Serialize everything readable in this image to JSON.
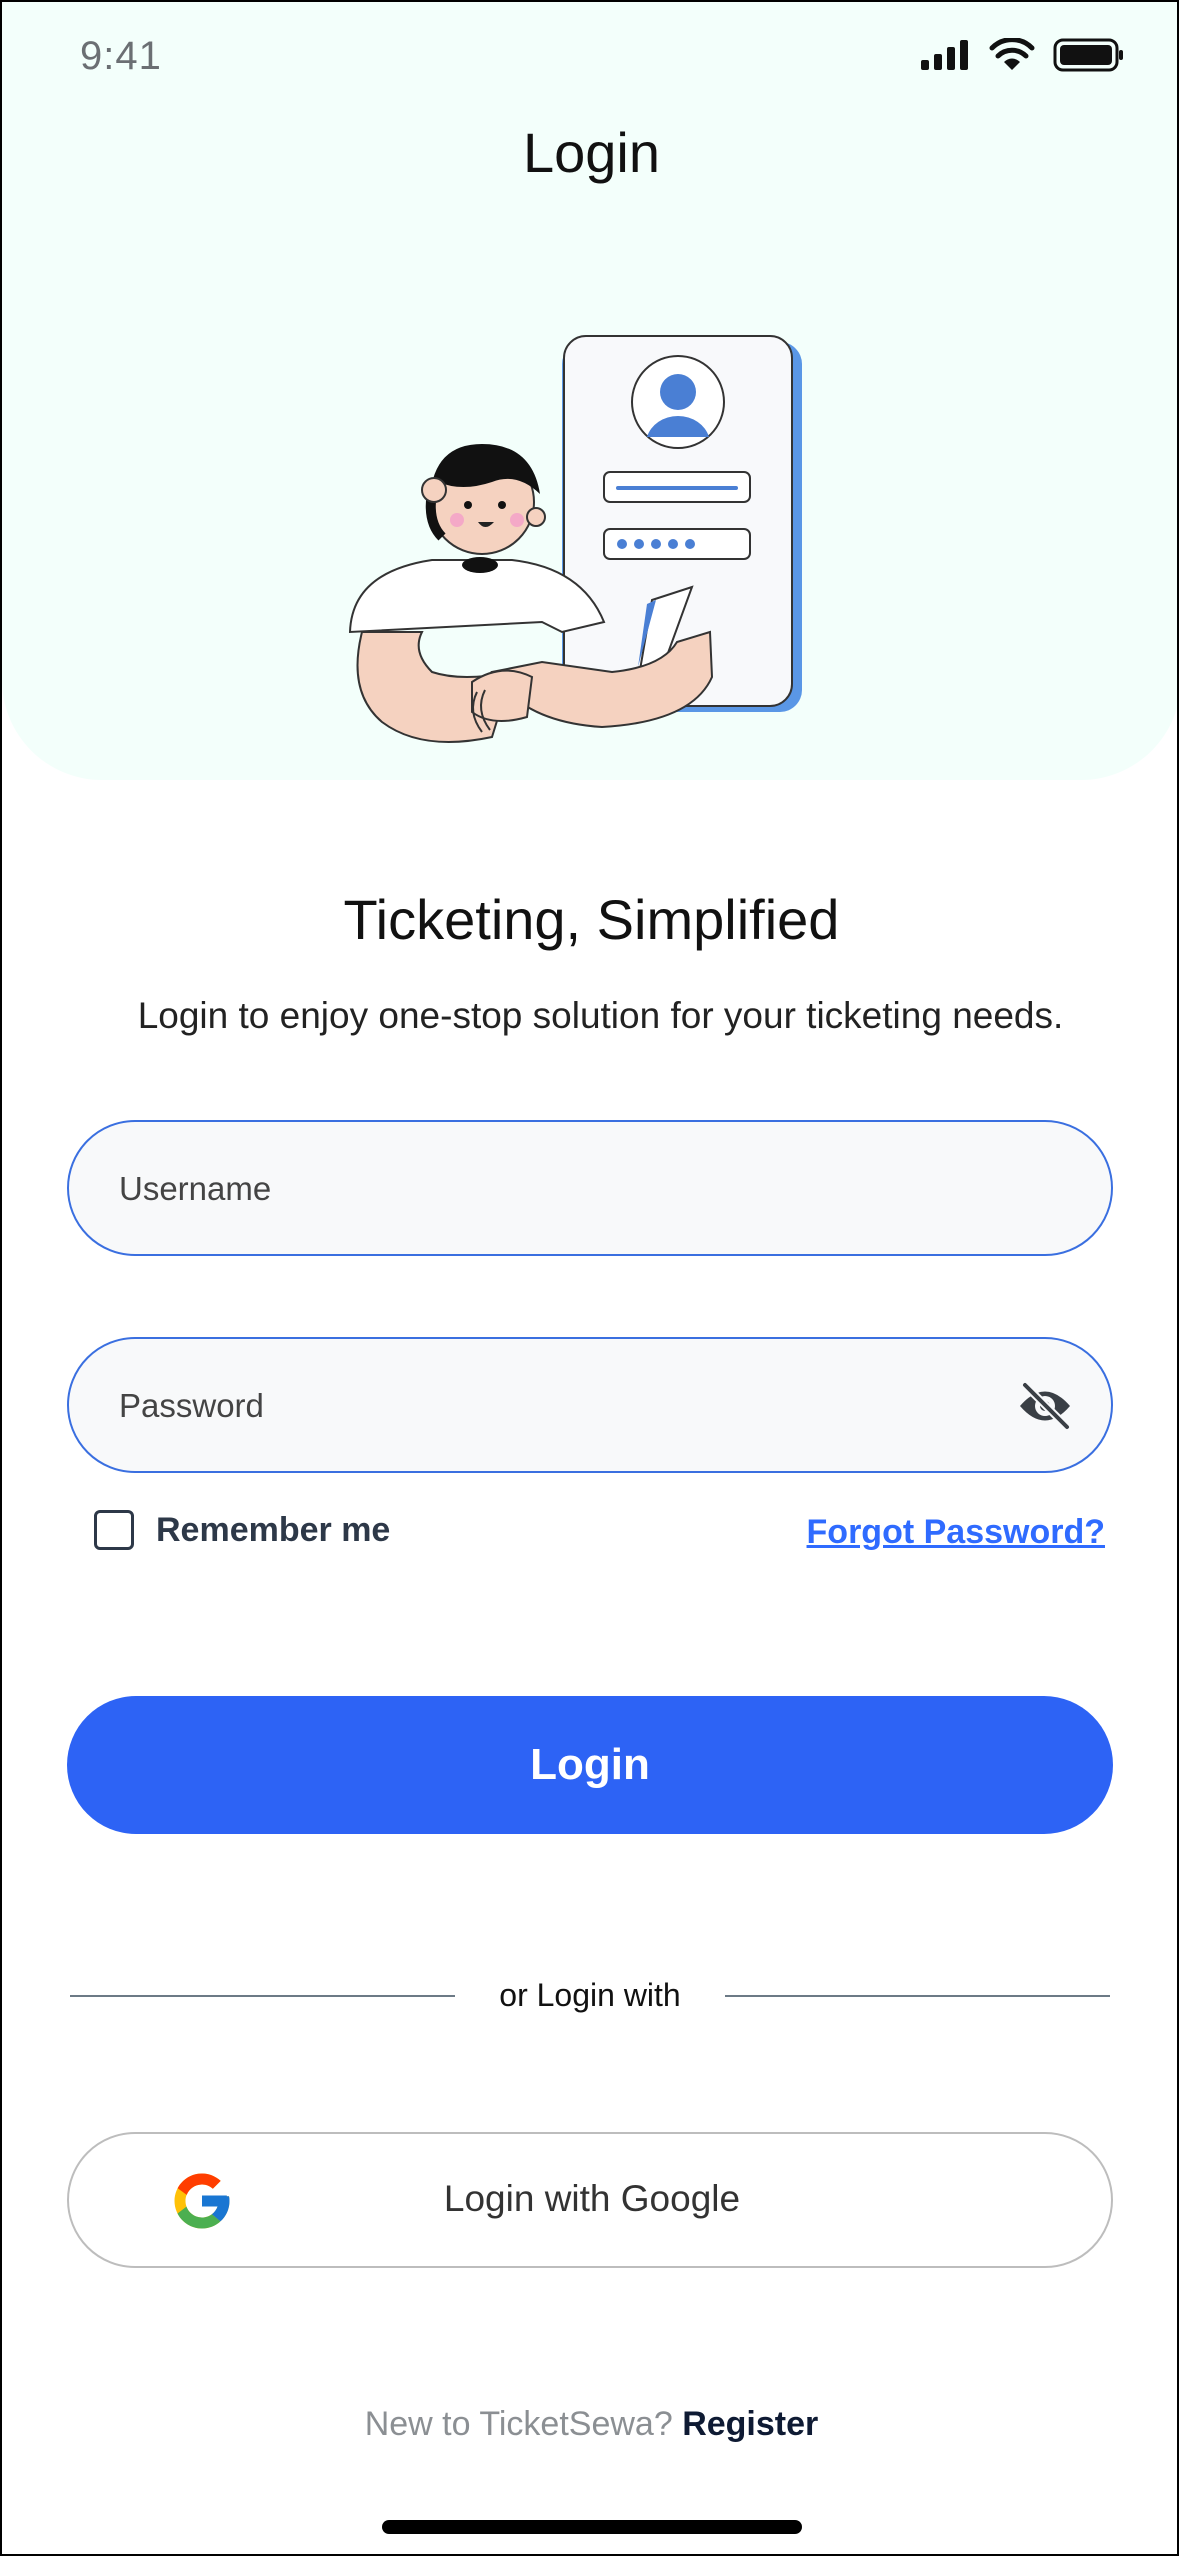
{
  "status_bar": {
    "time": "9:41"
  },
  "header": {
    "title": "Login"
  },
  "tagline": {
    "title": "Ticketing, Simplified",
    "subtitle": "Login to enjoy one-stop solution for your ticketing needs."
  },
  "form": {
    "username_placeholder": "Username",
    "password_placeholder": "Password",
    "remember_label": "Remember me",
    "forgot_label": "Forgot Password?",
    "login_label": "Login",
    "divider_text": "or Login with",
    "google_label": "Login with Google"
  },
  "footer": {
    "prompt": "New to TicketSewa?",
    "register_label": "Register"
  },
  "colors": {
    "primary": "#2d63f5",
    "link": "#2f6bff",
    "hero_bg": "#f3fffb",
    "field_border": "#3a6fe0"
  },
  "icons": [
    "signal-icon",
    "wifi-icon",
    "battery-icon",
    "eye-off-icon",
    "google-icon"
  ]
}
